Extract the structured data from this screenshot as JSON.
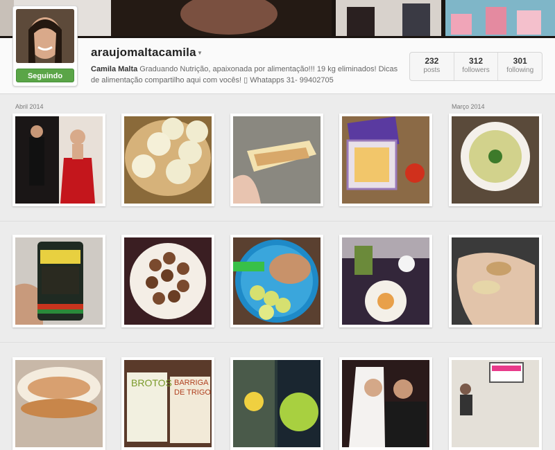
{
  "profile": {
    "username": "araujomaltacamila",
    "follow_label": "Seguindo",
    "bio_name": "Camila Malta",
    "bio_text": " Graduando Nutrição, apaixonada por alimentação!!! 19 kg eliminados! Dicas de alimentação compartilho aqui com vocês! ▯ Whatapps 31- 99402705"
  },
  "stats": {
    "posts": {
      "num": "232",
      "label": "posts"
    },
    "followers": {
      "num": "312",
      "label": "followers"
    },
    "following": {
      "num": "301",
      "label": "following"
    }
  },
  "months": {
    "april": "Abril 2014",
    "march": "Março 2014"
  },
  "colors": {
    "follow_green": "#5aa547",
    "background": "#ececec"
  },
  "icons": [
    "chevron-down-icon"
  ]
}
